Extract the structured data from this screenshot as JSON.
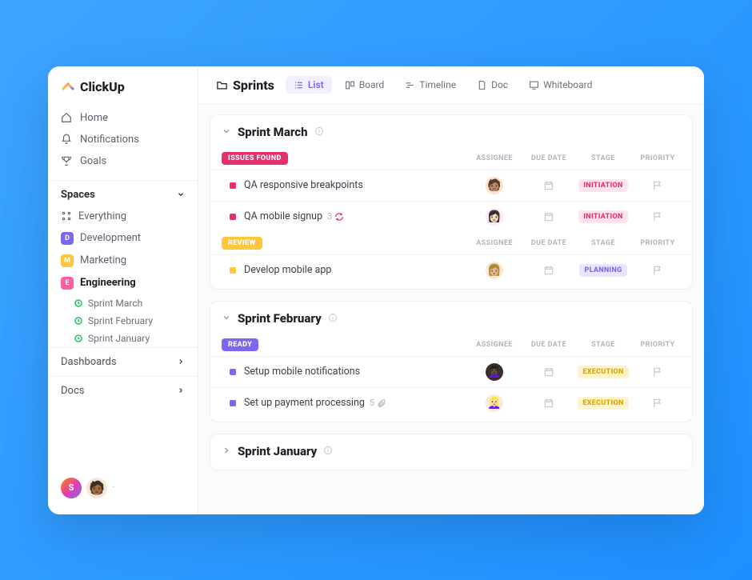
{
  "brand": "ClickUp",
  "nav": {
    "home": "Home",
    "notifications": "Notifications",
    "goals": "Goals"
  },
  "spaces": {
    "header": "Spaces",
    "everything": "Everything",
    "items": [
      {
        "initial": "D",
        "label": "Development",
        "color": "#7b68ee"
      },
      {
        "initial": "M",
        "label": "Marketing",
        "color": "#ffc53d"
      },
      {
        "initial": "E",
        "label": "Engineering",
        "color": "#ff5fa2"
      }
    ],
    "sprints": [
      "Sprint  March",
      "Sprint  February",
      "Sprint January"
    ]
  },
  "sections": {
    "dashboards": "Dashboards",
    "docs": "Docs"
  },
  "footer": {
    "user_initial": "S"
  },
  "topbar": {
    "title": "Sprints",
    "views": {
      "list": "List",
      "board": "Board",
      "timeline": "Timeline",
      "doc": "Doc",
      "whiteboard": "Whiteboard"
    }
  },
  "columns": {
    "assignee": "ASSIGNEE",
    "due": "DUE DATE",
    "stage": "STAGE",
    "priority": "PRIORITY"
  },
  "sprints": [
    {
      "title": "Sprint March",
      "groups": [
        {
          "label": "ISSUES FOUND",
          "color": "#e5306f",
          "dot": "#e5306f",
          "tasks": [
            {
              "name": "QA responsive breakpoints",
              "avatar_bg": "#ffe0cc",
              "avatar_emoji": "🧑🏽",
              "stage": "INITIATION",
              "stage_bg": "#ffe3ef",
              "stage_fg": "#e5306f"
            },
            {
              "name": "QA mobile signup",
              "count": "3",
              "recur": true,
              "avatar_bg": "#ffe9f2",
              "avatar_emoji": "👩🏻",
              "stage": "INITIATION",
              "stage_bg": "#ffe3ef",
              "stage_fg": "#e5306f"
            }
          ]
        },
        {
          "label": "REVIEW",
          "color": "#ffc53d",
          "dot": "#ffc53d",
          "tasks": [
            {
              "name": "Develop mobile app",
              "avatar_bg": "#fde7d6",
              "avatar_emoji": "👩🏼",
              "stage": "PLANNING",
              "stage_bg": "#e9e5ff",
              "stage_fg": "#7b68ee"
            }
          ]
        }
      ]
    },
    {
      "title": "Sprint February",
      "groups": [
        {
          "label": "READY",
          "color": "#7b68ee",
          "dot": "#7b68ee",
          "tasks": [
            {
              "name": "Setup mobile notifications",
              "avatar_bg": "#3a2e2a",
              "avatar_emoji": "👩🏿‍🦱",
              "stage": "EXECUTION",
              "stage_bg": "#fff3cc",
              "stage_fg": "#d9a400"
            },
            {
              "name": "Set up payment processing",
              "count": "5",
              "attach": true,
              "avatar_bg": "#fce9d6",
              "avatar_emoji": "👱🏻‍♀️",
              "stage": "EXECUTION",
              "stage_bg": "#fff3cc",
              "stage_fg": "#d9a400"
            }
          ]
        }
      ]
    },
    {
      "title": "Sprint January",
      "collapsed": true
    }
  ]
}
